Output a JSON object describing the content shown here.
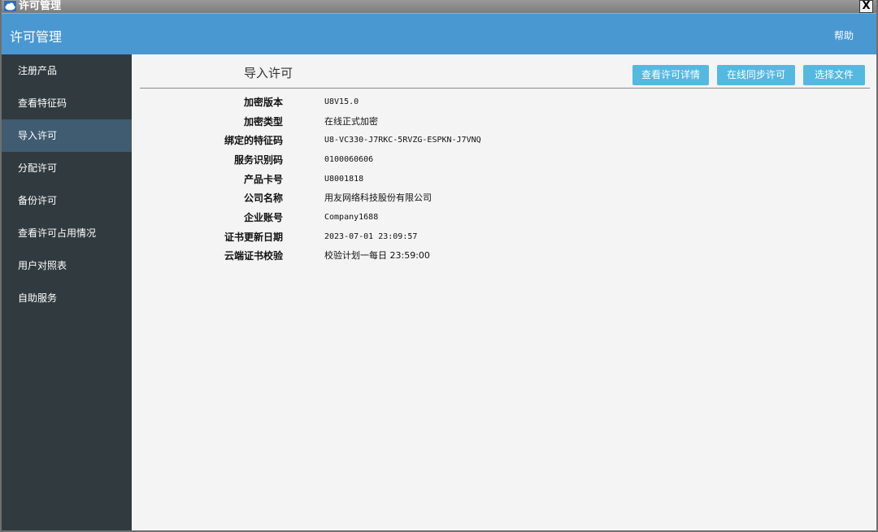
{
  "window": {
    "title": "许可管理",
    "close_label": "X"
  },
  "header": {
    "title": "许可管理",
    "help_label": "帮助"
  },
  "sidebar": {
    "items": [
      {
        "label": "注册产品"
      },
      {
        "label": "查看特征码"
      },
      {
        "label": "导入许可"
      },
      {
        "label": "分配许可"
      },
      {
        "label": "备份许可"
      },
      {
        "label": "查看许可占用情况"
      },
      {
        "label": "用户对照表"
      },
      {
        "label": "自助服务"
      }
    ],
    "active_label": "导入许可"
  },
  "main": {
    "section_title": "导入许可",
    "buttons": {
      "view_detail": "查看许可详情",
      "online_sync": "在线同步许可",
      "choose_file": "选择文件"
    },
    "info": [
      {
        "label": "加密版本",
        "value": "U8V15.0"
      },
      {
        "label": "加密类型",
        "value": "在线正式加密"
      },
      {
        "label": "绑定的特征码",
        "value": "U8-VC330-J7RKC-5RVZG-ESPKN-J7VNQ"
      },
      {
        "label": "服务识别码",
        "value": "0100060606"
      },
      {
        "label": "产品卡号",
        "value": "U8001818"
      },
      {
        "label": "公司名称",
        "value": "用友网络科技股份有限公司"
      },
      {
        "label": "企业账号",
        "value": "Company1688"
      },
      {
        "label": "证书更新日期",
        "value": "2023-07-01 23:09:57"
      },
      {
        "label": "云端证书校验",
        "value": "校验计划一每日  23:59:00"
      }
    ]
  },
  "colors": {
    "header_blue": "#4a98d2",
    "sidebar_bg": "#313b3f",
    "sidebar_active": "#3f5c70",
    "button_blue": "#55b8e1"
  }
}
